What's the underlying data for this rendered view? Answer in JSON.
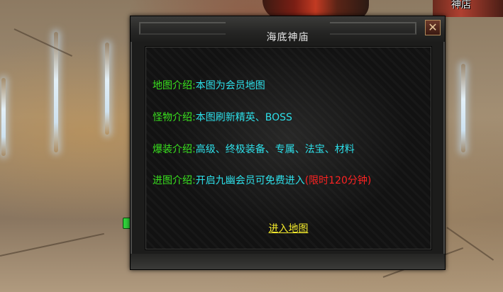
{
  "scene": {
    "npc_name": "神店"
  },
  "dialog": {
    "title": "海底神庙",
    "close_glyph": "✕",
    "rows": [
      {
        "label": "地图介绍:",
        "value": "本图为会员地图",
        "note": ""
      },
      {
        "label": "怪物介绍:",
        "value": "本图刷新精英、BOSS",
        "note": ""
      },
      {
        "label": "爆装介绍:",
        "value": "高级、终极装备、专属、法宝、材料",
        "note": ""
      },
      {
        "label": "进图介绍:",
        "value": "开启九幽会员可免费进入",
        "note": "(限时120分钟)"
      }
    ],
    "enter_link": "进入地图"
  },
  "colors": {
    "label": "#39e21e",
    "value": "#2de0ea",
    "note": "#ff2222",
    "link": "#f3ea2c",
    "title": "#e8e8e8"
  }
}
